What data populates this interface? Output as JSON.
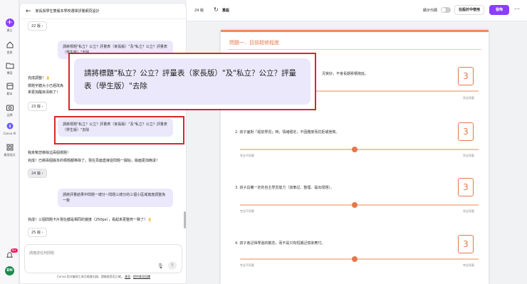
{
  "rail": {
    "items": [
      {
        "label": "建立",
        "icon": "plus-icon"
      },
      {
        "label": "首頁",
        "icon": "home-icon"
      },
      {
        "label": "專案",
        "icon": "folder-icon"
      },
      {
        "label": "範本",
        "icon": "template-icon"
      },
      {
        "label": "品牌",
        "icon": "brand-icon"
      },
      {
        "label": "Canva AI",
        "icon": "sparkle-icon"
      },
      {
        "label": "應用程式",
        "icon": "apps-icon"
      }
    ],
    "notification_count": "9+",
    "avatar_initials": "DH"
  },
  "chat": {
    "title": "家長與學生雙版本學校選擇評量網頁設計",
    "versions": {
      "v22": "22 版",
      "v23": "23 版",
      "v24": "24 版",
      "v25": "25 版"
    },
    "messages": {
      "user1": "請將標題\"私立？公立？評量表（家長版）\"及\"私立？公立？評量表（學生版）\"去除",
      "ai1_line1": "完成調整！👌",
      "ai1_line2": "標題字體大小已經改為",
      "ai1_line3": "來更加醒目清晰了！",
      "user2": "請將標題\"私立？公立？評量表（家長版）\"及\"私立？公立？評量表（學生版）\"去除",
      "ai2_line1": "我來幫您移除這兩個標題！",
      "ai2_line2": "完成！已將兩個版本的標題都移除了，現在頁面直接從問題一開始，版面更加簡潔！",
      "user3": "請將評量結果中問題一總分~問題三總分的三個小區域寬度調整為一致",
      "ai3": "完成！三個問題卡片現在都是相同的寬度（250px），看起來更整齊一致了！👌"
    },
    "input_placeholder": "請描述任何問題",
    "footer": "Canva 程式編寫工具可能會出錯，請檢查是否正確。",
    "footer_link1": "意見",
    "footer_link2": "提供意見回饋"
  },
  "callout": {
    "text": "請將標題\"私立？公立？評量表（家長版）\"及\"私立？公立？評量表（學生版）\"去除"
  },
  "topbar": {
    "version": "24 版",
    "refresh_label": "重設",
    "code_toggle_label": "顯示代碼",
    "use_design_label": "在設計中使用",
    "publish_label": "發佈",
    "more_icon": "more-icon"
  },
  "preview": {
    "section_title": "問題一．目前超修程度",
    "questions": [
      {
        "text": "況良好，不會長期累積拖延。",
        "score": "3"
      },
      {
        "text": "2. 孩子面對「超前學習」時，情緒穩定，不因難度而抗拒或挫敗。",
        "score": "3"
      },
      {
        "text": "3. 孩子具備一定的自主學習能力（如筆記、整理、提出問題）。",
        "score": "3"
      },
      {
        "text": "4. 孩子會記得學過的觀念，而不是只有短期記憶來應付。",
        "score": "3"
      }
    ],
    "slider_left": "完全不同意",
    "slider_right": "完全同意"
  }
}
